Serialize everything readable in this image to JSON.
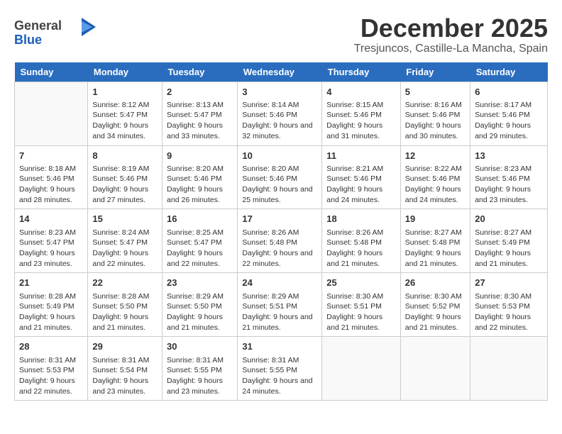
{
  "header": {
    "logo_line1": "General",
    "logo_line2": "Blue",
    "month": "December 2025",
    "location": "Tresjuncos, Castille-La Mancha, Spain"
  },
  "days_of_week": [
    "Sunday",
    "Monday",
    "Tuesday",
    "Wednesday",
    "Thursday",
    "Friday",
    "Saturday"
  ],
  "weeks": [
    [
      {
        "day": "",
        "sunrise": "",
        "sunset": "",
        "daylight": ""
      },
      {
        "day": "1",
        "sunrise": "Sunrise: 8:12 AM",
        "sunset": "Sunset: 5:47 PM",
        "daylight": "Daylight: 9 hours and 34 minutes."
      },
      {
        "day": "2",
        "sunrise": "Sunrise: 8:13 AM",
        "sunset": "Sunset: 5:47 PM",
        "daylight": "Daylight: 9 hours and 33 minutes."
      },
      {
        "day": "3",
        "sunrise": "Sunrise: 8:14 AM",
        "sunset": "Sunset: 5:46 PM",
        "daylight": "Daylight: 9 hours and 32 minutes."
      },
      {
        "day": "4",
        "sunrise": "Sunrise: 8:15 AM",
        "sunset": "Sunset: 5:46 PM",
        "daylight": "Daylight: 9 hours and 31 minutes."
      },
      {
        "day": "5",
        "sunrise": "Sunrise: 8:16 AM",
        "sunset": "Sunset: 5:46 PM",
        "daylight": "Daylight: 9 hours and 30 minutes."
      },
      {
        "day": "6",
        "sunrise": "Sunrise: 8:17 AM",
        "sunset": "Sunset: 5:46 PM",
        "daylight": "Daylight: 9 hours and 29 minutes."
      }
    ],
    [
      {
        "day": "7",
        "sunrise": "Sunrise: 8:18 AM",
        "sunset": "Sunset: 5:46 PM",
        "daylight": "Daylight: 9 hours and 28 minutes."
      },
      {
        "day": "8",
        "sunrise": "Sunrise: 8:19 AM",
        "sunset": "Sunset: 5:46 PM",
        "daylight": "Daylight: 9 hours and 27 minutes."
      },
      {
        "day": "9",
        "sunrise": "Sunrise: 8:20 AM",
        "sunset": "Sunset: 5:46 PM",
        "daylight": "Daylight: 9 hours and 26 minutes."
      },
      {
        "day": "10",
        "sunrise": "Sunrise: 8:20 AM",
        "sunset": "Sunset: 5:46 PM",
        "daylight": "Daylight: 9 hours and 25 minutes."
      },
      {
        "day": "11",
        "sunrise": "Sunrise: 8:21 AM",
        "sunset": "Sunset: 5:46 PM",
        "daylight": "Daylight: 9 hours and 24 minutes."
      },
      {
        "day": "12",
        "sunrise": "Sunrise: 8:22 AM",
        "sunset": "Sunset: 5:46 PM",
        "daylight": "Daylight: 9 hours and 24 minutes."
      },
      {
        "day": "13",
        "sunrise": "Sunrise: 8:23 AM",
        "sunset": "Sunset: 5:46 PM",
        "daylight": "Daylight: 9 hours and 23 minutes."
      }
    ],
    [
      {
        "day": "14",
        "sunrise": "Sunrise: 8:23 AM",
        "sunset": "Sunset: 5:47 PM",
        "daylight": "Daylight: 9 hours and 23 minutes."
      },
      {
        "day": "15",
        "sunrise": "Sunrise: 8:24 AM",
        "sunset": "Sunset: 5:47 PM",
        "daylight": "Daylight: 9 hours and 22 minutes."
      },
      {
        "day": "16",
        "sunrise": "Sunrise: 8:25 AM",
        "sunset": "Sunset: 5:47 PM",
        "daylight": "Daylight: 9 hours and 22 minutes."
      },
      {
        "day": "17",
        "sunrise": "Sunrise: 8:26 AM",
        "sunset": "Sunset: 5:48 PM",
        "daylight": "Daylight: 9 hours and 22 minutes."
      },
      {
        "day": "18",
        "sunrise": "Sunrise: 8:26 AM",
        "sunset": "Sunset: 5:48 PM",
        "daylight": "Daylight: 9 hours and 21 minutes."
      },
      {
        "day": "19",
        "sunrise": "Sunrise: 8:27 AM",
        "sunset": "Sunset: 5:48 PM",
        "daylight": "Daylight: 9 hours and 21 minutes."
      },
      {
        "day": "20",
        "sunrise": "Sunrise: 8:27 AM",
        "sunset": "Sunset: 5:49 PM",
        "daylight": "Daylight: 9 hours and 21 minutes."
      }
    ],
    [
      {
        "day": "21",
        "sunrise": "Sunrise: 8:28 AM",
        "sunset": "Sunset: 5:49 PM",
        "daylight": "Daylight: 9 hours and 21 minutes."
      },
      {
        "day": "22",
        "sunrise": "Sunrise: 8:28 AM",
        "sunset": "Sunset: 5:50 PM",
        "daylight": "Daylight: 9 hours and 21 minutes."
      },
      {
        "day": "23",
        "sunrise": "Sunrise: 8:29 AM",
        "sunset": "Sunset: 5:50 PM",
        "daylight": "Daylight: 9 hours and 21 minutes."
      },
      {
        "day": "24",
        "sunrise": "Sunrise: 8:29 AM",
        "sunset": "Sunset: 5:51 PM",
        "daylight": "Daylight: 9 hours and 21 minutes."
      },
      {
        "day": "25",
        "sunrise": "Sunrise: 8:30 AM",
        "sunset": "Sunset: 5:51 PM",
        "daylight": "Daylight: 9 hours and 21 minutes."
      },
      {
        "day": "26",
        "sunrise": "Sunrise: 8:30 AM",
        "sunset": "Sunset: 5:52 PM",
        "daylight": "Daylight: 9 hours and 21 minutes."
      },
      {
        "day": "27",
        "sunrise": "Sunrise: 8:30 AM",
        "sunset": "Sunset: 5:53 PM",
        "daylight": "Daylight: 9 hours and 22 minutes."
      }
    ],
    [
      {
        "day": "28",
        "sunrise": "Sunrise: 8:31 AM",
        "sunset": "Sunset: 5:53 PM",
        "daylight": "Daylight: 9 hours and 22 minutes."
      },
      {
        "day": "29",
        "sunrise": "Sunrise: 8:31 AM",
        "sunset": "Sunset: 5:54 PM",
        "daylight": "Daylight: 9 hours and 23 minutes."
      },
      {
        "day": "30",
        "sunrise": "Sunrise: 8:31 AM",
        "sunset": "Sunset: 5:55 PM",
        "daylight": "Daylight: 9 hours and 23 minutes."
      },
      {
        "day": "31",
        "sunrise": "Sunrise: 8:31 AM",
        "sunset": "Sunset: 5:55 PM",
        "daylight": "Daylight: 9 hours and 24 minutes."
      },
      {
        "day": "",
        "sunrise": "",
        "sunset": "",
        "daylight": ""
      },
      {
        "day": "",
        "sunrise": "",
        "sunset": "",
        "daylight": ""
      },
      {
        "day": "",
        "sunrise": "",
        "sunset": "",
        "daylight": ""
      }
    ]
  ]
}
